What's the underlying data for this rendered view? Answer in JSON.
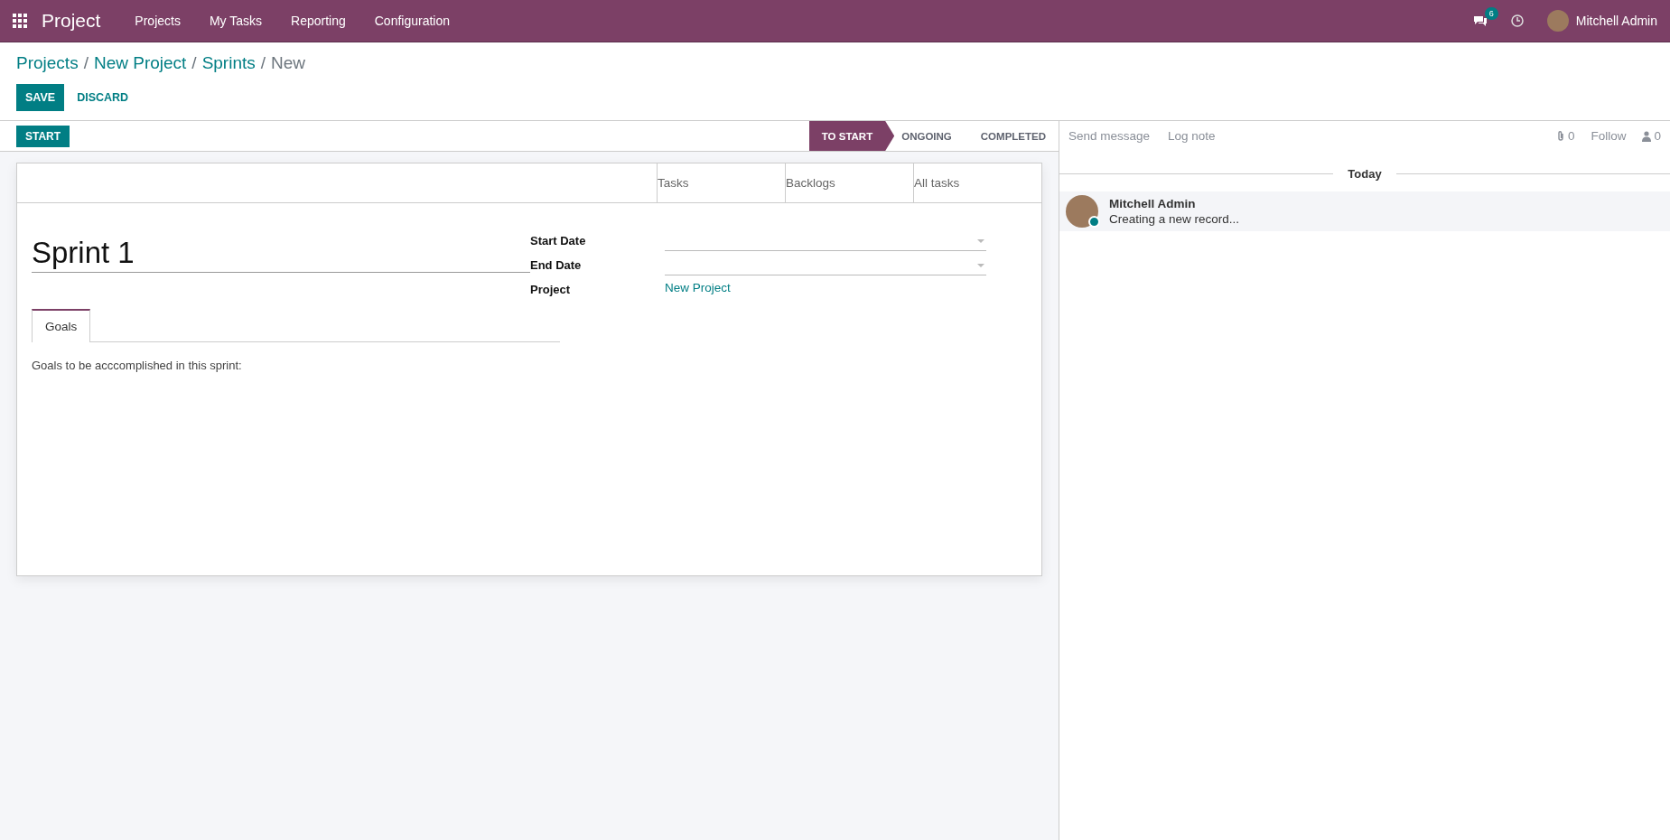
{
  "navbar": {
    "app_name": "Project",
    "menu": [
      "Projects",
      "My Tasks",
      "Reporting",
      "Configuration"
    ],
    "messages_count": "6",
    "user_name": "Mitchell Admin"
  },
  "breadcrumbs": [
    {
      "label": "Projects",
      "link": true
    },
    {
      "separator": "/",
      "label": "New Project",
      "link": true
    },
    {
      "separator": "/",
      "label": "Sprints",
      "link": true
    },
    {
      "separator": "/",
      "label": "New",
      "link": false
    }
  ],
  "actions": {
    "save": "SAVE",
    "discard": "DISCARD"
  },
  "statusbar": {
    "button": "START",
    "stages": [
      {
        "label": "TO START",
        "selected": true
      },
      {
        "label": "ONGOING",
        "selected": false
      },
      {
        "label": "COMPLETED",
        "selected": false
      }
    ]
  },
  "smart_buttons": [
    "Tasks",
    "Backlogs",
    "All tasks"
  ],
  "form": {
    "name": "Sprint 1",
    "fields": [
      {
        "label": "Start Date",
        "kind": "date"
      },
      {
        "label": "End Date",
        "kind": "date"
      },
      {
        "label": "Project",
        "kind": "link",
        "value": "New Project"
      }
    ],
    "tabs": [
      {
        "label": "Goals",
        "selected": true
      }
    ],
    "goals_text": "Goals to be acccomplished in this sprint:"
  },
  "chatter": {
    "send_message": "Send message",
    "log_note": "Log note",
    "attachments": "0",
    "follow": "Follow",
    "followers": "0",
    "date_separator": "Today",
    "messages": [
      {
        "author": "Mitchell Admin",
        "body": "Creating a new record...",
        "online": true
      }
    ]
  }
}
